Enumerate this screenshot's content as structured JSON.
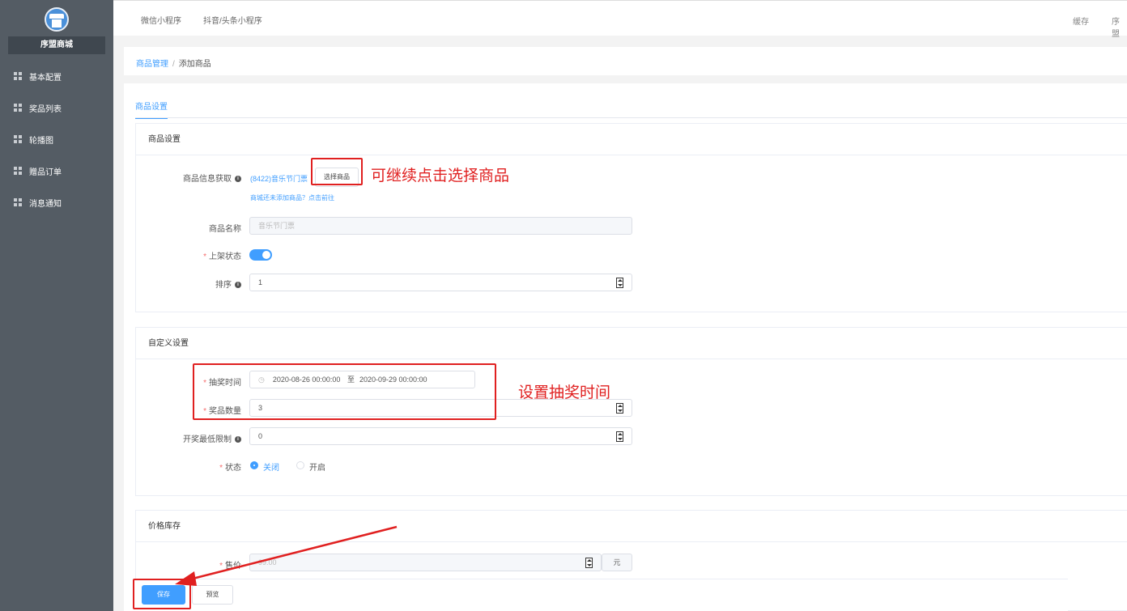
{
  "sidebar": {
    "store_name": "序盟商城",
    "items": [
      {
        "label": "基本配置"
      },
      {
        "label": "奖品列表"
      },
      {
        "label": "轮播图"
      },
      {
        "label": "赠品订单"
      },
      {
        "label": "消息通知"
      }
    ]
  },
  "topbar": {
    "tabs": [
      "微信小程序",
      "抖音/头条小程序"
    ],
    "right": [
      "缓存",
      "序盟"
    ]
  },
  "breadcrumb": {
    "parent": "商品管理",
    "separator": "/",
    "current": "添加商品"
  },
  "tab": {
    "label": "商品设置"
  },
  "section_goods": {
    "title": "商品设置",
    "info_label": "商品信息获取",
    "info_value": "(8422)音乐节门票",
    "select_button": "选择商品",
    "hint": "商城还未添加商品？点击前往",
    "name_label": "商品名称",
    "name_placeholder": "音乐节门票",
    "status_label": "上架状态",
    "status_on": true,
    "sort_label": "排序",
    "sort_value": "1"
  },
  "section_custom": {
    "title": "自定义设置",
    "time_label": "抽奖时间",
    "time_start": "2020-08-26 00:00:00",
    "time_sep": "至",
    "time_end": "2020-09-29 00:00:00",
    "count_label": "奖品数量",
    "count_value": "3",
    "min_label": "开奖最低限制",
    "min_value": "0",
    "state_label": "状态",
    "state_options": [
      "关闭",
      "开启"
    ],
    "state_selected": "关闭"
  },
  "section_price": {
    "title": "价格库存",
    "price_label": "售价",
    "price_value": "99.00",
    "unit": "元"
  },
  "footer": {
    "save": "保存",
    "preview": "预览"
  },
  "annotations": {
    "select_goods": "可继续点击选择商品",
    "set_time": "设置抽奖时间"
  },
  "colors": {
    "primary": "#409eff",
    "sidebar": "#545c64",
    "annotation": "#e02020"
  }
}
